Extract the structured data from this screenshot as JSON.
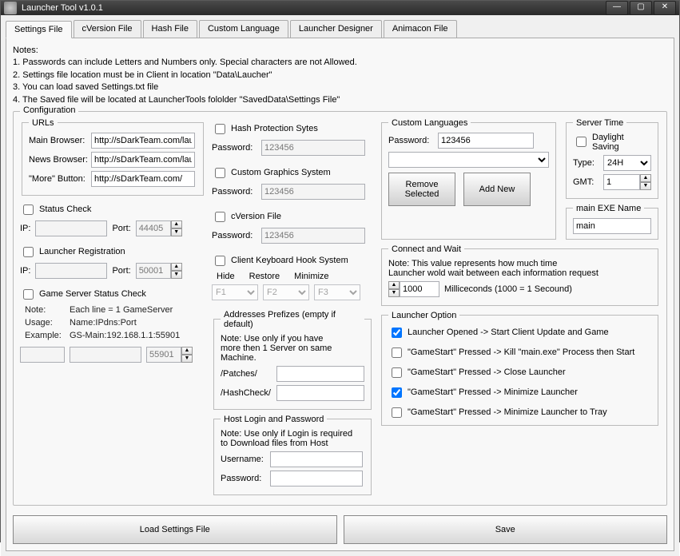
{
  "window": {
    "title": "Launcher Tool v1.0.1"
  },
  "tabs": [
    "Settings File",
    "cVersion File",
    "Hash File",
    "Custom Language",
    "Launcher Designer",
    "Animacon File"
  ],
  "notes": {
    "heading": "Notes:",
    "l1": "1. Passwords can include Letters and Numbers only. Special characters are not Allowed.",
    "l2": "2. Settings file location must be in Client in location \"Data\\Laucher\"",
    "l3": "3. You can load saved Settings.txt file",
    "l4": "4. The Saved file will be located at LauncherTools fololder \"SavedData\\Settings File\""
  },
  "config": {
    "legend": "Configuration",
    "urls": {
      "legend": "URLs",
      "main_label": "Main Browser:",
      "main_value": "http://sDarkTeam.com/laur",
      "news_label": "News Browser:",
      "news_value": "http://sDarkTeam.com/laur",
      "more_label": "\"More\" Button:",
      "more_value": "http://sDarkTeam.com/"
    },
    "status_check": {
      "label": "Status Check",
      "ip_label": "IP:",
      "ip_value": "",
      "port_label": "Port:",
      "port_value": "44405"
    },
    "launcher_reg": {
      "label": "Launcher Registration",
      "ip_label": "IP:",
      "ip_value": "",
      "port_label": "Port:",
      "port_value": "50001"
    },
    "gss": {
      "label": "Game Server Status Check",
      "note_k": "Note:",
      "note_v": "Each line = 1 GameServer",
      "usage_k": "Usage:",
      "usage_v": "Name:IPdns:Port",
      "example_k": "Example:",
      "example_v": "GS-Main:192.168.1.1:55901",
      "f1": "",
      "f2": "",
      "port": "55901"
    },
    "hash": {
      "label": "Hash Protection Sytes",
      "pw_label": "Password:",
      "pw_value": "123456"
    },
    "cgs": {
      "label": "Custom Graphics System",
      "pw_label": "Password:",
      "pw_value": "123456"
    },
    "cver": {
      "label": "cVersion File",
      "pw_label": "Password:",
      "pw_value": "123456"
    },
    "khook": {
      "label": "Client Keyboard Hook System",
      "hide_l": "Hide",
      "hide_v": "F1",
      "restore_l": "Restore",
      "restore_v": "F2",
      "min_l": "Minimize",
      "min_v": "F3"
    },
    "addr": {
      "legend": "Addresses Prefizes (empty if default)",
      "note1": "Note: Use only if you have",
      "note2": "more then 1 Server on same Machine.",
      "patches_l": "/Patches/",
      "patches_v": "",
      "hash_l": "/HashCheck/",
      "hash_v": ""
    },
    "host": {
      "legend": "Host Login and Password",
      "note1": "Note: Use only if Login is required",
      "note2": "to Download files from Host",
      "user_l": "Username:",
      "user_v": "",
      "pass_l": "Password:",
      "pass_v": ""
    },
    "custlang": {
      "legend": "Custom Languages",
      "pw_label": "Password:",
      "pw_value": "123456",
      "select_value": "",
      "remove": "Remove Selected",
      "add": "Add New"
    },
    "connect": {
      "legend": "Connect and Wait",
      "note1": "Note: This value represents how much time",
      "note2": "Launcher wold wait between each information request",
      "value": "1000",
      "suffix": "Milliceconds (1000 = 1 Secound)"
    },
    "options": {
      "legend": "Launcher Option",
      "o1": "Launcher Opened -> Start Client Update and Game",
      "o2": "\"GameStart\" Pressed -> Kill \"main.exe\" Process then Start",
      "o3": "\"GameStart\" Pressed -> Close Launcher",
      "o4": "\"GameStart\" Pressed -> Minimize Launcher",
      "o5": "\"GameStart\" Pressed -> Minimize Launcher to Tray",
      "c1": true,
      "c2": false,
      "c3": false,
      "c4": true,
      "c5": false
    },
    "servertime": {
      "legend": "Server Time",
      "daylight": "Daylight Saving",
      "type_l": "Type:",
      "type_v": "24H",
      "gmt_l": "GMT:",
      "gmt_v": "1"
    },
    "exe": {
      "legend": "main EXE Name",
      "value": "main"
    }
  },
  "buttons": {
    "load": "Load Settings File",
    "save": "Save"
  }
}
